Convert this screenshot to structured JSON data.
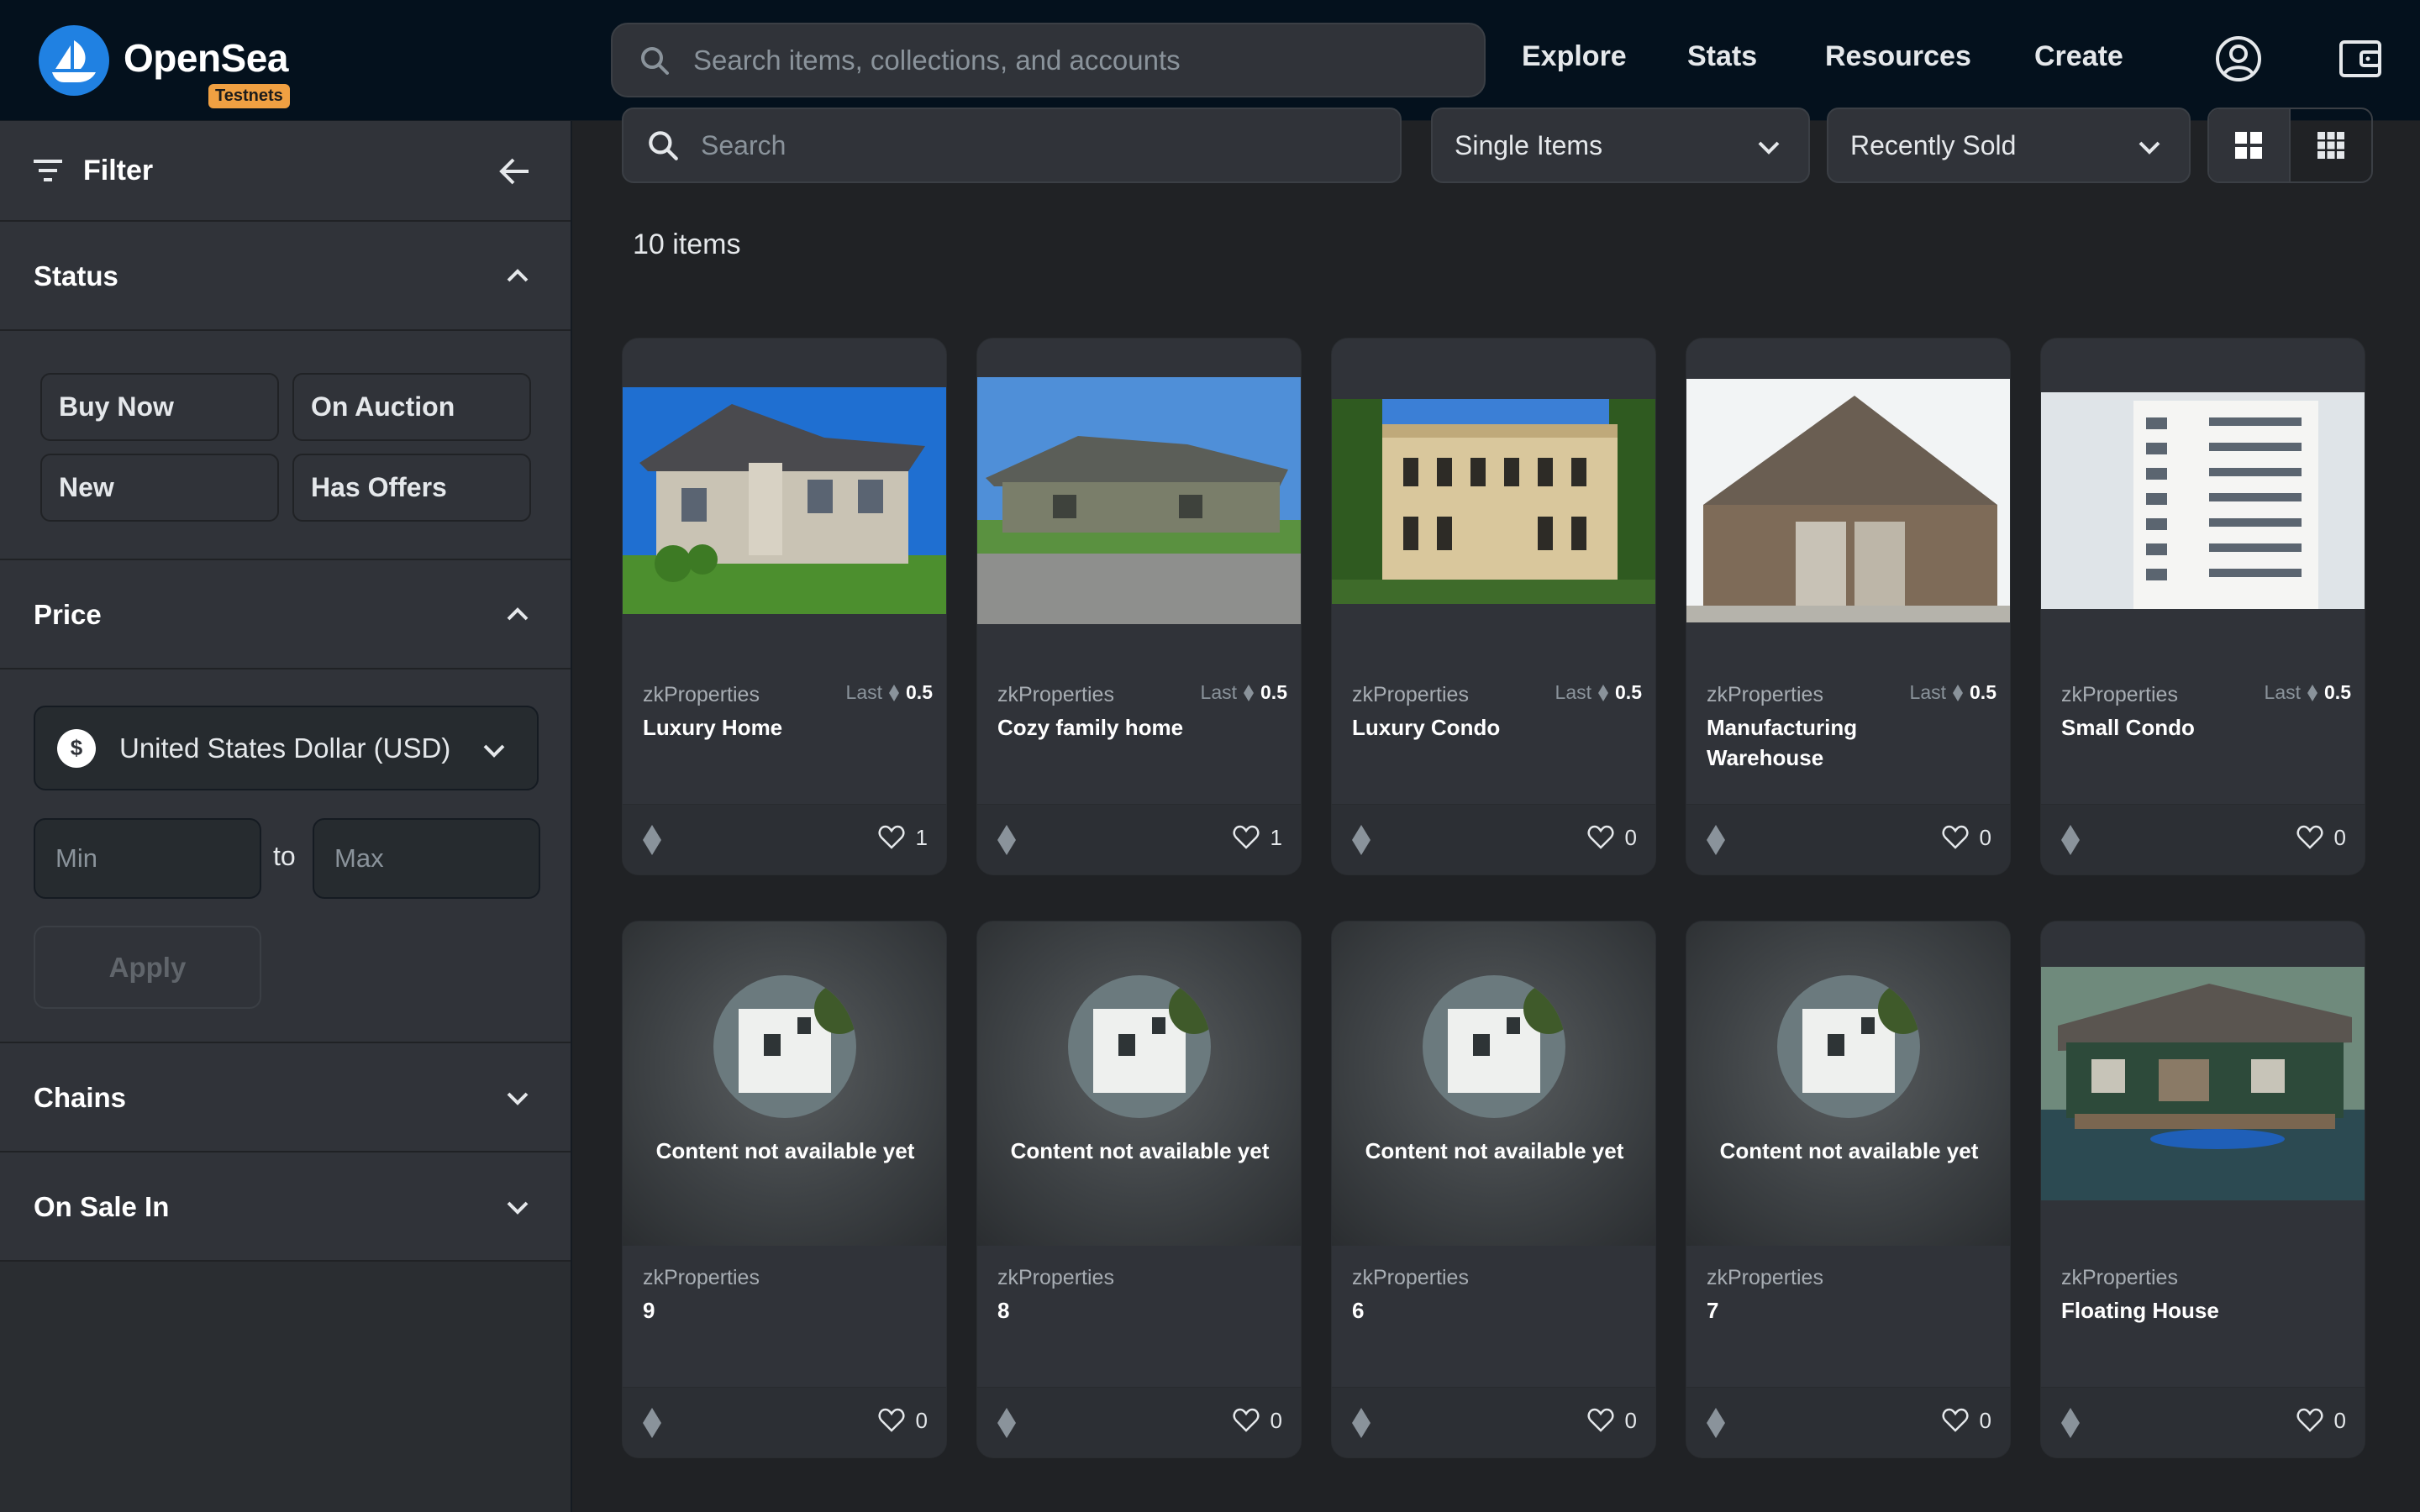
{
  "navbar": {
    "brand": "OpenSea",
    "badge": "Testnets",
    "search_placeholder": "Search items, collections, and accounts",
    "links": [
      "Explore",
      "Stats",
      "Resources",
      "Create"
    ]
  },
  "sidebar": {
    "filter_label": "Filter",
    "status": {
      "title": "Status",
      "chips": [
        "Buy Now",
        "On Auction",
        "New",
        "Has Offers"
      ]
    },
    "price": {
      "title": "Price",
      "currency": "United States Dollar (USD)",
      "currency_symbol": "$",
      "min_placeholder": "Min",
      "to_label": "to",
      "max_placeholder": "Max",
      "apply_label": "Apply"
    },
    "chains_title": "Chains",
    "on_sale_title": "On Sale In"
  },
  "toolbar": {
    "search_placeholder": "Search",
    "items_filter": "Single Items",
    "sort": "Recently Sold"
  },
  "item_count": "10 items",
  "colors": {
    "accent": "#2081e2",
    "background": "#202225",
    "panel": "#303339",
    "navbar": "#04111d",
    "badge": "#f0a042"
  },
  "cards": [
    {
      "collection": "zkProperties",
      "name": "Luxury Home",
      "last_label": "Last",
      "last_price": "0.5",
      "likes": "1",
      "image": "house-photo"
    },
    {
      "collection": "zkProperties",
      "name": "Cozy family home",
      "last_label": "Last",
      "last_price": "0.5",
      "likes": "1",
      "image": "ranch-house-photo"
    },
    {
      "collection": "zkProperties",
      "name": "Luxury Condo",
      "last_label": "Last",
      "last_price": "0.5",
      "likes": "0",
      "image": "mansion-photo"
    },
    {
      "collection": "zkProperties",
      "name": "Manufacturing Warehouse",
      "last_label": "Last",
      "last_price": "0.5",
      "likes": "0",
      "image": "barn-photo"
    },
    {
      "collection": "zkProperties",
      "name": "Small Condo",
      "last_label": "Last",
      "last_price": "0.5",
      "likes": "0",
      "image": "tower-photo"
    },
    {
      "collection": "zkProperties",
      "name": "9",
      "likes": "0",
      "placeholder": "Content not available yet"
    },
    {
      "collection": "zkProperties",
      "name": "8",
      "likes": "0",
      "placeholder": "Content not available yet"
    },
    {
      "collection": "zkProperties",
      "name": "6",
      "likes": "0",
      "placeholder": "Content not available yet"
    },
    {
      "collection": "zkProperties",
      "name": "7",
      "likes": "0",
      "placeholder": "Content not available yet"
    },
    {
      "collection": "zkProperties",
      "name": "Floating House",
      "likes": "0",
      "image": "houseboat-photo"
    }
  ]
}
